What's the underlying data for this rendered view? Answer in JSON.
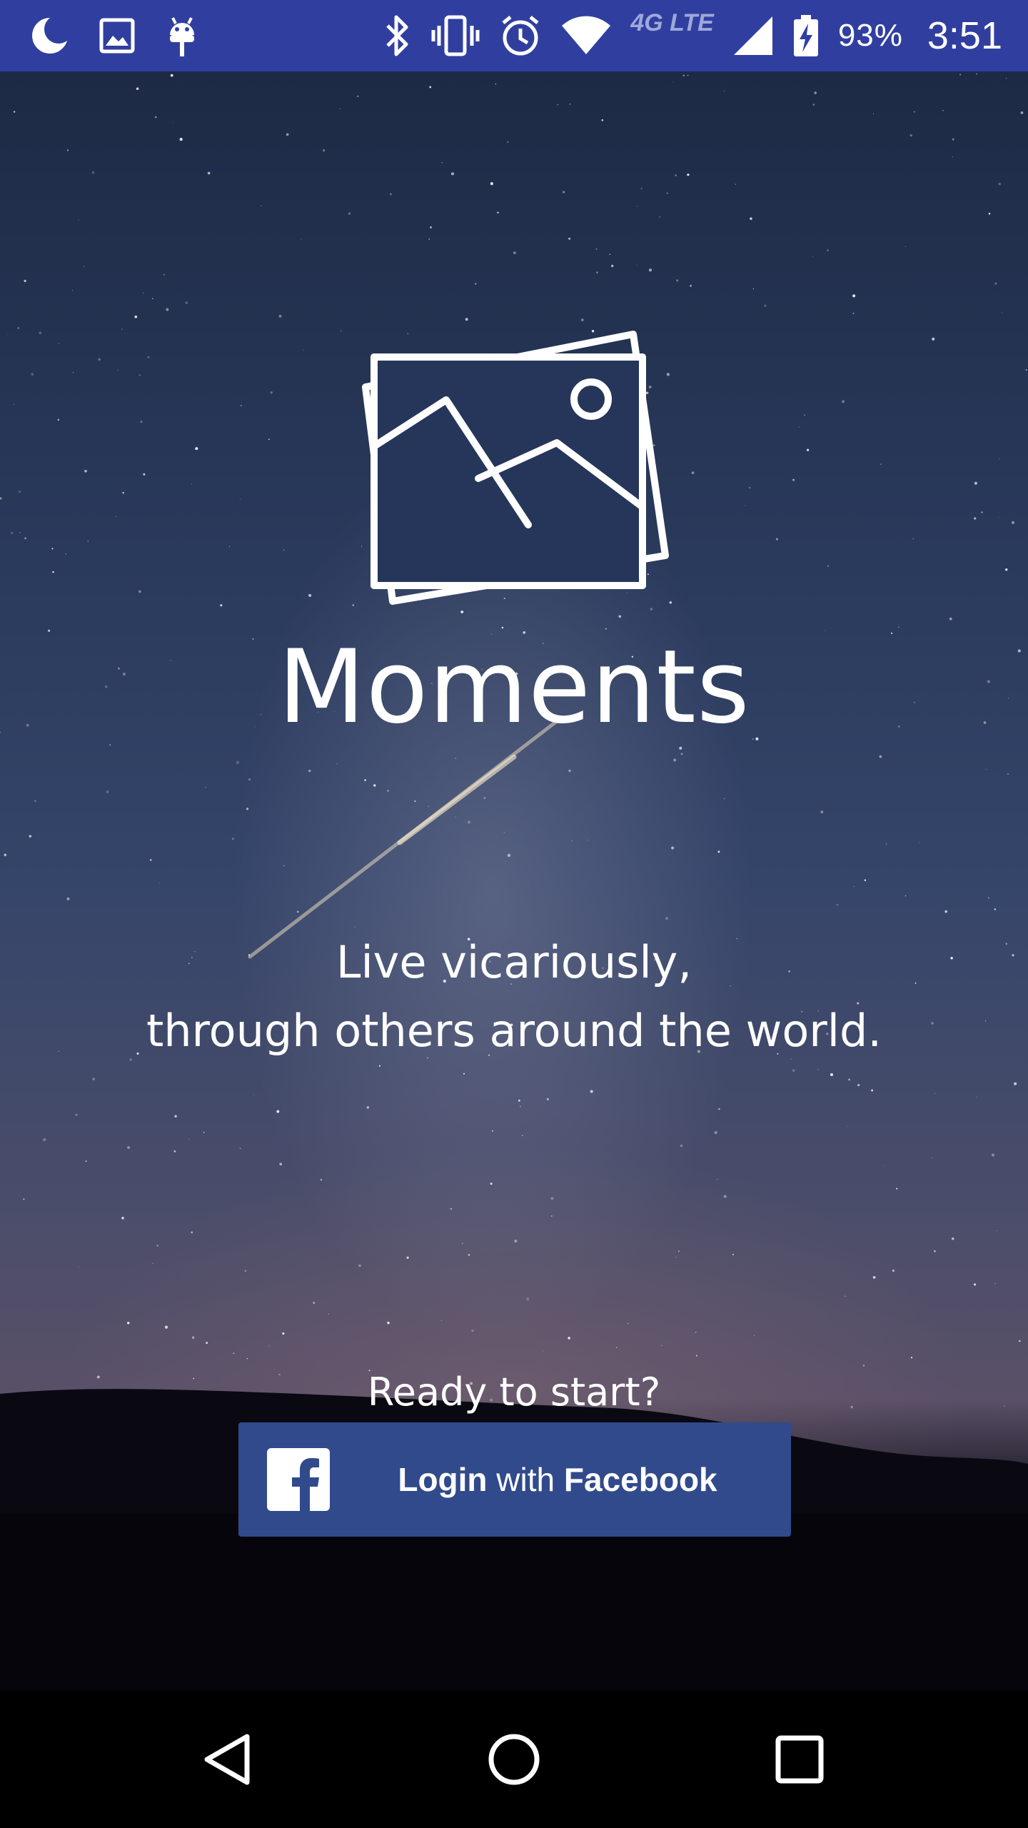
{
  "status_bar": {
    "left_icons": [
      "moon-icon",
      "image-notification-icon",
      "android-debug-icon"
    ],
    "right_icons": [
      "bluetooth-icon",
      "vibrate-icon",
      "alarm-icon",
      "wifi-icon",
      "signal-icon",
      "battery-charging-icon"
    ],
    "network_label": "4G LTE",
    "battery_percent": "93%",
    "time": "3:51",
    "background_color": "#303f9f"
  },
  "main": {
    "logo_icon": "photos-stack-icon",
    "app_title": "Moments",
    "tagline_line1": "Live vicariously,",
    "tagline_line2": "through others around the world.",
    "ready_text": "Ready to start?",
    "login_button": {
      "icon": "facebook-icon",
      "label_part1": "Login",
      "label_part2": " with ",
      "label_part3": "Facebook",
      "background_color": "#314a8c"
    }
  },
  "nav_bar": {
    "buttons": [
      "back-icon",
      "home-icon",
      "recents-icon"
    ]
  }
}
